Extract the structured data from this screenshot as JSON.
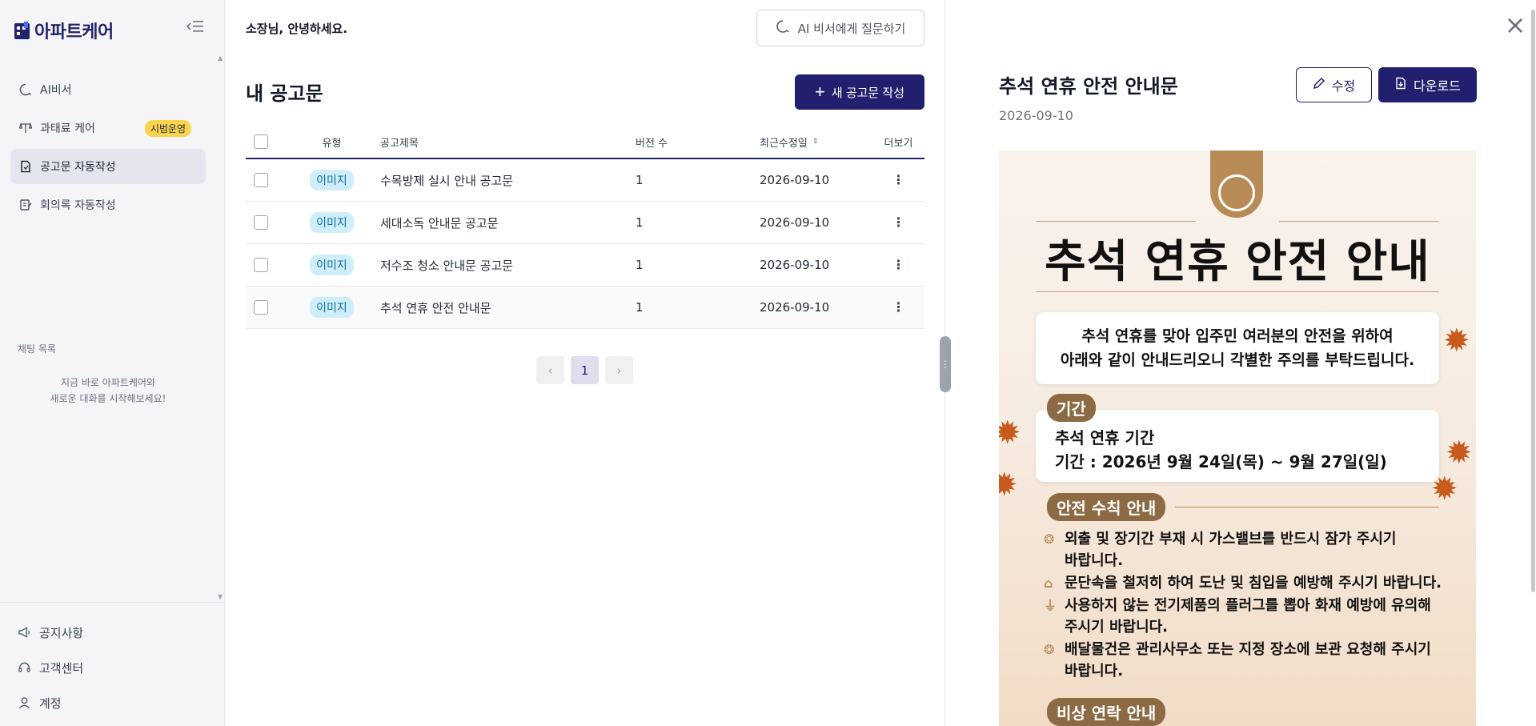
{
  "brand": {
    "name": "아파트케어",
    "color": "#22256b"
  },
  "sidebar": {
    "items": [
      {
        "label": "AI비서",
        "icon": "ai-chat-icon"
      },
      {
        "label": "과태료 케어",
        "icon": "scale-icon",
        "badge": "시범운영"
      },
      {
        "label": "공고문 자동작성",
        "icon": "document-icon",
        "active": true
      },
      {
        "label": "회의록 자동작성",
        "icon": "minutes-icon"
      }
    ],
    "chat_title": "채팅 목록",
    "chat_empty_line1": "지금 바로 아파트케어와",
    "chat_empty_line2": "새로운 대화를 시작해보세요!",
    "bottom": [
      {
        "label": "공지사항",
        "icon": "megaphone-icon"
      },
      {
        "label": "고객센터",
        "icon": "headset-icon"
      },
      {
        "label": "계정",
        "icon": "user-icon"
      }
    ]
  },
  "header": {
    "greeting": "소장님, 안녕하세요.",
    "ai_button": "AI 비서에게 질문하기"
  },
  "main": {
    "title": "내 공고문",
    "new_button": "새 공고문 작성",
    "columns": {
      "type": "유형",
      "title": "공고제목",
      "version": "버전 수",
      "updated": "최근수정일",
      "more": "더보기"
    },
    "rows": [
      {
        "type": "이미지",
        "title": "수목방제 실시 안내 공고문",
        "version": "1",
        "updated": "2026-09-10"
      },
      {
        "type": "이미지",
        "title": "세대소독 안내문 공고문",
        "version": "1",
        "updated": "2026-09-10"
      },
      {
        "type": "이미지",
        "title": "저수조 청소 안내문 공고문",
        "version": "1",
        "updated": "2026-09-10"
      },
      {
        "type": "이미지",
        "title": "추석 연휴 안전 안내문",
        "version": "1",
        "updated": "2026-09-10"
      }
    ],
    "pagination": {
      "prev": "‹",
      "current": "1",
      "next": "›"
    }
  },
  "preview": {
    "title": "추석 연휴 안전 안내문",
    "date": "2026-09-10",
    "edit_button": "수정",
    "download_button": "다운로드",
    "poster": {
      "headline": "추석 연휴 안전 안내",
      "intro_line1": "추석 연휴를 맞아 입주민 여러분의 안전을 위하여",
      "intro_line2": "아래와 같이 안내드리오니 각별한 주의를 부탁드립니다.",
      "period_label": "기간",
      "period_line1": "추석 연휴 기간",
      "period_line2": "기간 : 2026년 9월 24일(목) ~ 9월 27일(일)",
      "safety_label": "안전 수칙 안내",
      "safety_items": [
        {
          "l1": "외출 및 장기간 부재 시 가스밸브를 반드시 잠가 주시기",
          "l2": "바랍니다."
        },
        {
          "l1": "문단속을 철저히 하여 도난 및 침입을 예방해 주시기 바랍니다.",
          "l2": ""
        },
        {
          "l1": "사용하지 않는 전기제품의 플러그를 뽑아 화재 예방에 유의해",
          "l2": "주시기 바랍니다."
        },
        {
          "l1": "배달물건은 관리사무소 또는 지정 장소에 보관 요청해 주시기",
          "l2": "바랍니다."
        }
      ],
      "emergency_label": "비상 연락 안내"
    }
  },
  "colors": {
    "primary": "#22206e",
    "badge_yellow": "#fcd34d",
    "type_badge": "#cfeefb",
    "poster_brown": "#8c6a44"
  }
}
